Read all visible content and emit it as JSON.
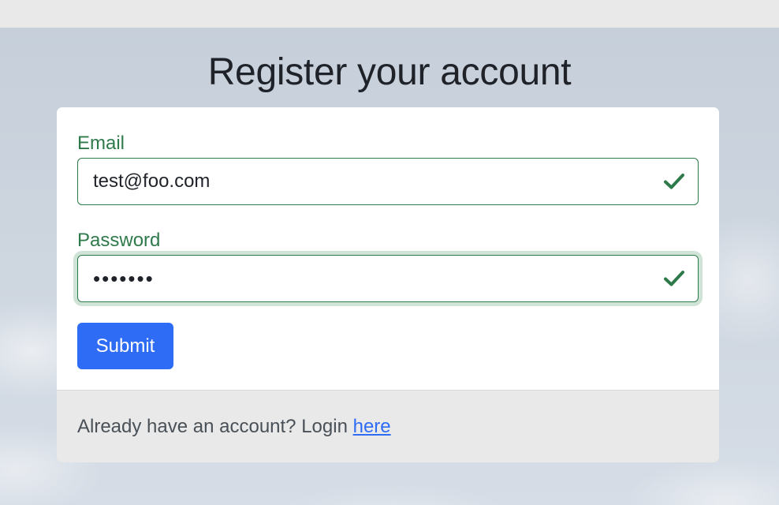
{
  "page": {
    "title": "Register your account"
  },
  "form": {
    "email": {
      "label": "Email",
      "value": "test@foo.com",
      "state": "valid"
    },
    "password": {
      "label": "Password",
      "value": "•••••••",
      "state": "valid"
    },
    "submit_label": "Submit"
  },
  "footer": {
    "text": "Already have an account? Login ",
    "link_label": "here"
  },
  "colors": {
    "valid": "#2f7a4b",
    "primary": "#2e6cf6",
    "title": "#1f2329"
  },
  "icons": {
    "valid_indicator": "check-icon"
  }
}
